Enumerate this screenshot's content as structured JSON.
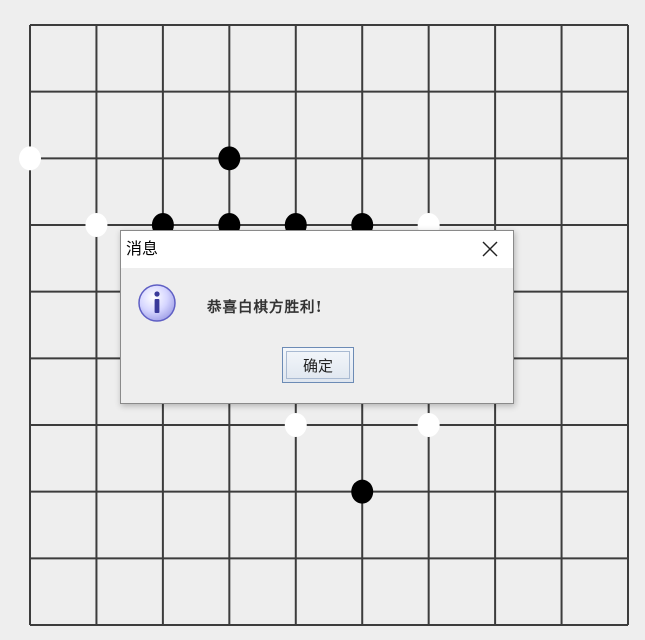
{
  "board": {
    "columns": 10,
    "rows": 10,
    "background_color": "#eeeeee",
    "line_color": "#3c3c3c",
    "stones": [
      {
        "col": 0,
        "row": 2,
        "color": "white"
      },
      {
        "col": 3,
        "row": 2,
        "color": "black"
      },
      {
        "col": 1,
        "row": 3,
        "color": "white"
      },
      {
        "col": 2,
        "row": 3,
        "color": "black"
      },
      {
        "col": 3,
        "row": 3,
        "color": "black"
      },
      {
        "col": 4,
        "row": 3,
        "color": "black"
      },
      {
        "col": 5,
        "row": 3,
        "color": "black"
      },
      {
        "col": 6,
        "row": 3,
        "color": "white"
      },
      {
        "col": 4,
        "row": 6,
        "color": "white"
      },
      {
        "col": 6,
        "row": 6,
        "color": "white"
      },
      {
        "col": 5,
        "row": 7,
        "color": "black"
      }
    ]
  },
  "dialog": {
    "title": "消息",
    "message": "恭喜白棋方胜利!",
    "ok_label": "确定",
    "icon": "info-icon",
    "close_icon": "close-icon"
  }
}
